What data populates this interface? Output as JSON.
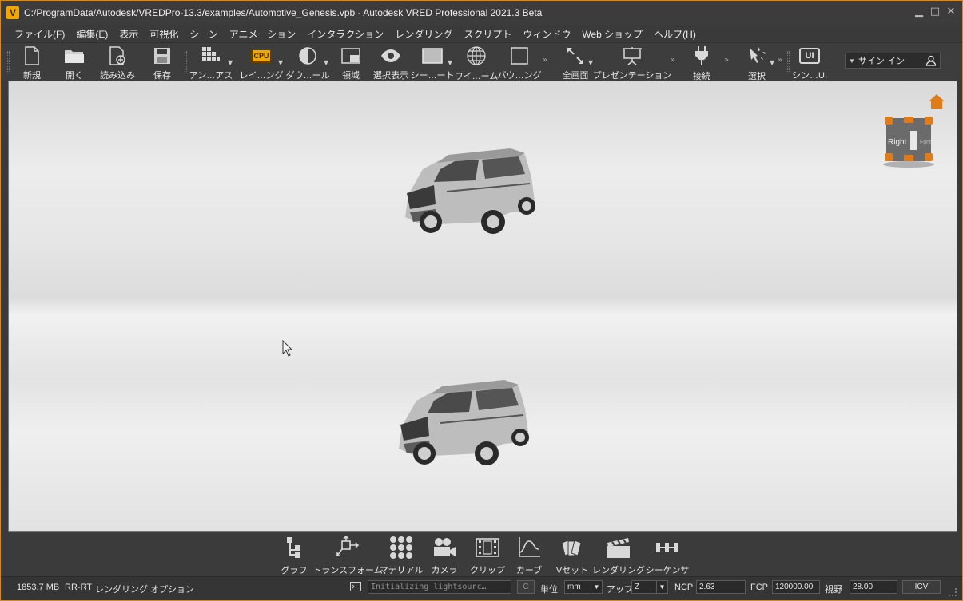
{
  "window": {
    "title": "C:/ProgramData/Autodesk/VREDPro-13.3/examples/Automotive_Genesis.vpb - Autodesk VRED Professional 2021.3 Beta",
    "logo_letter": "V",
    "minimize": "▁",
    "maximize": "□",
    "close": "✕"
  },
  "menu": [
    "ファイル(F)",
    "編集(E)",
    "表示",
    "可視化",
    "シーン",
    "アニメーション",
    "インタラクション",
    "レンダリング",
    "スクリプト",
    "ウィンドウ",
    "Web ショップ",
    "ヘルプ(H)"
  ],
  "toolbar": {
    "new": "新規",
    "open": "開く",
    "import": "読み込み",
    "save": "保存",
    "antialias": "アン…アス",
    "raytracing": "レイ…ング",
    "cpu_badge": "CPU",
    "download": "ダウ…ール",
    "region": "領域",
    "selection_show": "選択表示",
    "scene_plate": "シー…ート",
    "wireframe": "ワイ…ーム",
    "bounding": "バウ…ング",
    "fullscreen": "全画面",
    "presentation": "プレゼンテーション",
    "connect": "接続",
    "select": "選択",
    "scene_ui": "シン…UI",
    "ui_badge": "UI",
    "signin": "サイン イン"
  },
  "navcube": {
    "face_right": "Right",
    "face_front": "Font"
  },
  "modules": [
    "グラフ",
    "トランスフォーム",
    "マテリアル",
    "カメラ",
    "クリップ",
    "カーブ",
    "Vセット",
    "レンダリング",
    "シーケンサ"
  ],
  "status": {
    "memory": "1853.7 MB",
    "mode": "RR-RT",
    "render_options": "レンダリング オプション",
    "log_message": "Initializing lightsourc…",
    "c_button": "C",
    "unit_label": "単位",
    "unit_value": "mm",
    "up_label": "アップ",
    "up_value": "Z",
    "ncp_label": "NCP",
    "ncp_value": "2.63",
    "fcp_label": "FCP",
    "fcp_value": "120000.00",
    "fov_label": "視野",
    "fov_value": "28.00",
    "icv_button": "ICV"
  },
  "colors": {
    "accent": "#d08a2a",
    "cpu_badge": "#f2a700",
    "home_icon": "#e07b1a"
  }
}
